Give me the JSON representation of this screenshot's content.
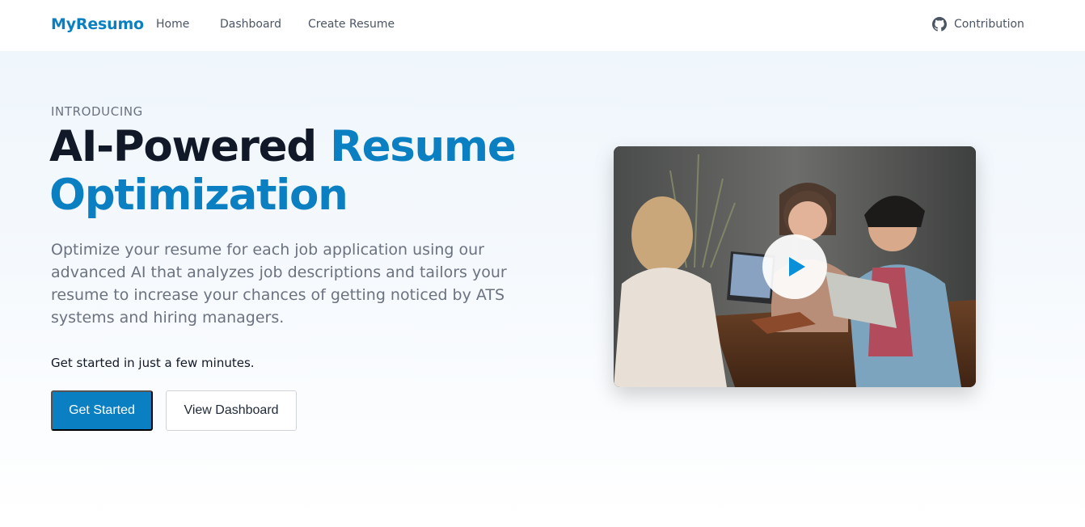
{
  "nav": {
    "brand": "MyResumo",
    "links": [
      "Home",
      "Dashboard",
      "Create Resume"
    ],
    "contribution": "Contribution"
  },
  "hero": {
    "eyebrow": "INTRODUCING",
    "headline_dark": "AI-Powered",
    "headline_accent_1": "Resume",
    "headline_accent_2": "Optimization",
    "lead": "Optimize your resume for each job application using our advanced AI that analyzes job descriptions and tailors your resume to increase your chances of getting noticed by ATS systems and hiring managers.",
    "sub": "Get started in just a few minutes.",
    "primary_button": "Get Started",
    "secondary_button": "View Dashboard"
  },
  "media": {
    "play_icon": "play-icon"
  },
  "colors": {
    "accent": "#0a7fc2",
    "text_dark": "#111827",
    "text_muted": "#6b7280",
    "hero_bg": "#eff6fc"
  }
}
